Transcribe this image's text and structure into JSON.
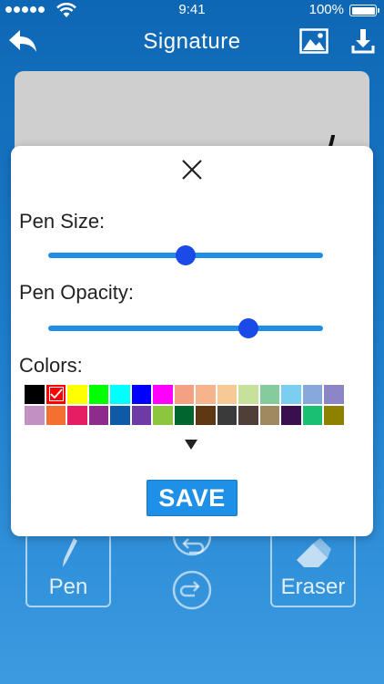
{
  "status_bar": {
    "time": "9:41",
    "battery_pct": "100%",
    "signal_icon": "signal-dots-icon",
    "wifi_icon": "wifi-icon",
    "battery_icon": "battery-icon"
  },
  "nav": {
    "title": "Signature",
    "back_icon": "back-arrow-icon",
    "image_icon": "image-icon",
    "download_icon": "download-icon"
  },
  "toolbar": {
    "pen_label": "Pen",
    "eraser_label": "Eraser",
    "undo_icon": "undo-icon",
    "redo_icon": "redo-icon"
  },
  "modal": {
    "close_icon": "close-icon",
    "pen_size_label": "Pen Size:",
    "pen_size_value": 0.5,
    "pen_opacity_label": "Pen Opacity:",
    "pen_opacity_value": 0.73,
    "colors_label": "Colors:",
    "more_colors_icon": "triangle-down-icon",
    "save_label": "SAVE"
  },
  "colors": {
    "primary": "#1e90e8",
    "slider_thumb": "#1a4be8",
    "selected_color": "#ff0000",
    "row1": [
      "#000000",
      "#ff0000",
      "#ffff00",
      "#00ff00",
      "#00ffff",
      "#0000ff",
      "#ff00ff",
      "#f4a083",
      "#f6b48c",
      "#f7c994",
      "#c7e09b",
      "#84cc9e",
      "#7bcef0",
      "#86a8dc",
      "#8c86c6"
    ],
    "row2": [
      "#c390c4",
      "#f47030",
      "#e71d63",
      "#8e2c8e",
      "#0e5aa7",
      "#6d3aa6",
      "#8cc63f",
      "#00652e",
      "#5d3813",
      "#3a3a3a",
      "#4f3f38",
      "#a08860",
      "#3a0f4f",
      "#1bbf73",
      "#8c8200"
    ]
  }
}
